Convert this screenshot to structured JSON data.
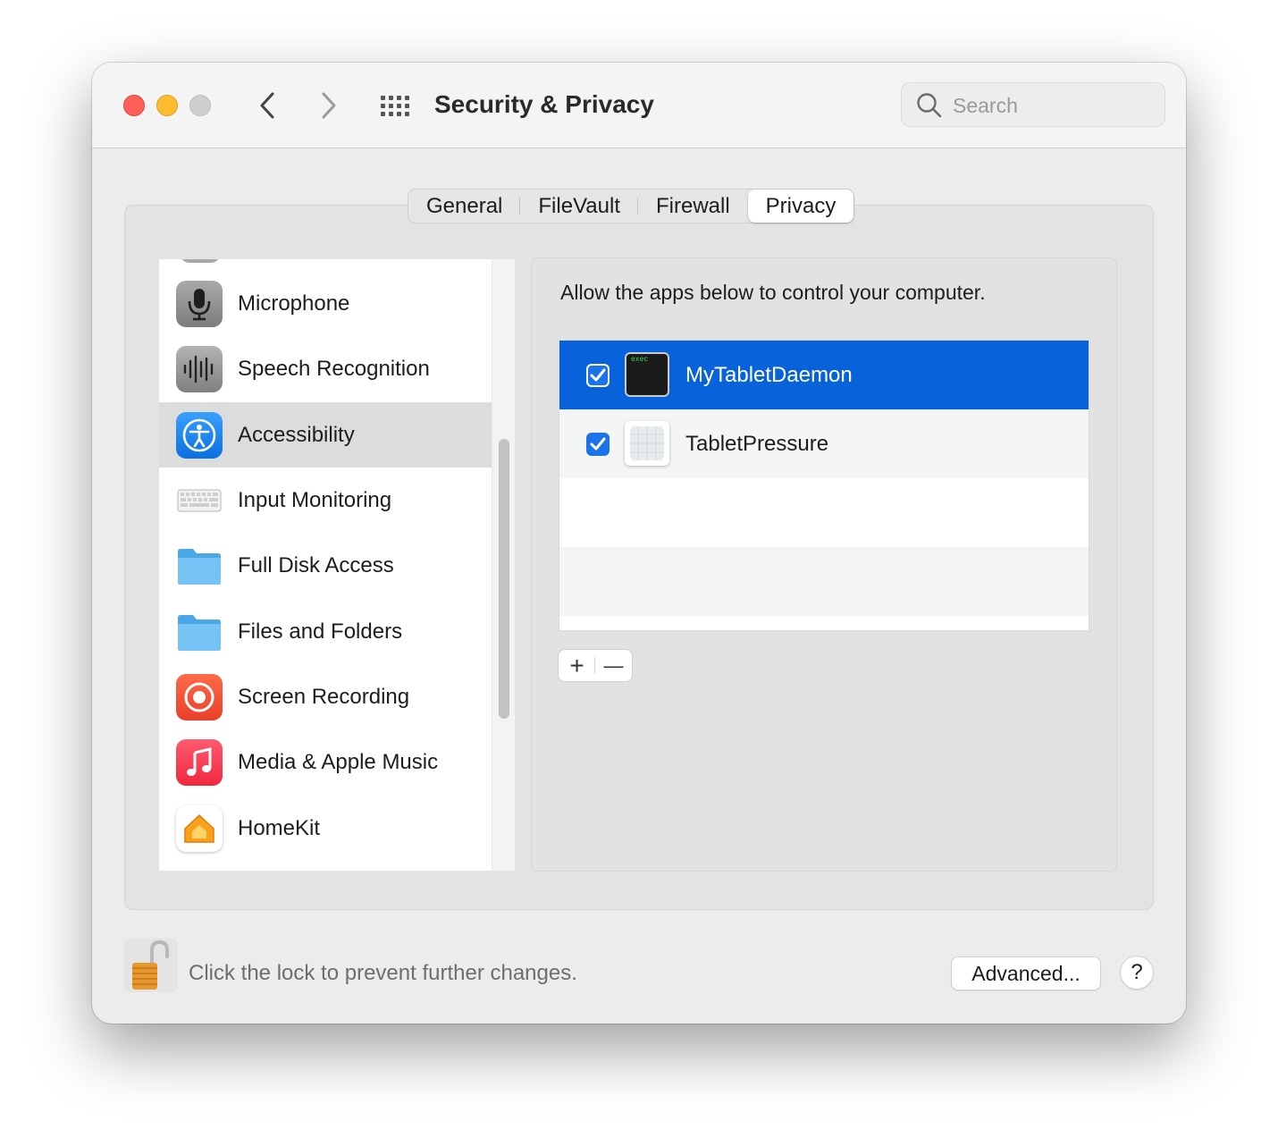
{
  "window": {
    "title": "Security & Privacy",
    "search_placeholder": "Search"
  },
  "tabs": [
    {
      "label": "General"
    },
    {
      "label": "FileVault"
    },
    {
      "label": "Firewall"
    },
    {
      "label": "Privacy",
      "active": true
    }
  ],
  "sidebar": {
    "items": [
      {
        "label": "Microphone",
        "icon": "microphone-icon"
      },
      {
        "label": "Speech Recognition",
        "icon": "waveform-icon"
      },
      {
        "label": "Accessibility",
        "icon": "accessibility-icon",
        "selected": true
      },
      {
        "label": "Input Monitoring",
        "icon": "keyboard-icon"
      },
      {
        "label": "Full Disk Access",
        "icon": "folder-icon"
      },
      {
        "label": "Files and Folders",
        "icon": "folder-icon"
      },
      {
        "label": "Screen Recording",
        "icon": "screen-record-icon"
      },
      {
        "label": "Media & Apple Music",
        "icon": "music-note-icon"
      },
      {
        "label": "HomeKit",
        "icon": "home-icon"
      }
    ]
  },
  "detail": {
    "description": "Allow the apps below to control your computer.",
    "apps": [
      {
        "name": "MyTabletDaemon",
        "checked": true,
        "selected": true,
        "icon": "terminal-exec-icon",
        "icon_text": "exec"
      },
      {
        "name": "TabletPressure",
        "checked": true,
        "selected": false,
        "icon": "app-generic-icon"
      }
    ],
    "add_symbol": "+",
    "remove_symbol": "—"
  },
  "footer": {
    "lock_text": "Click the lock to prevent further changes.",
    "advanced_label": "Advanced...",
    "help_label": "?"
  },
  "colors": {
    "selection": "#0862d9",
    "close": "#fe5f57",
    "minimize": "#febb2e",
    "checkbox": "#1a73e8"
  }
}
